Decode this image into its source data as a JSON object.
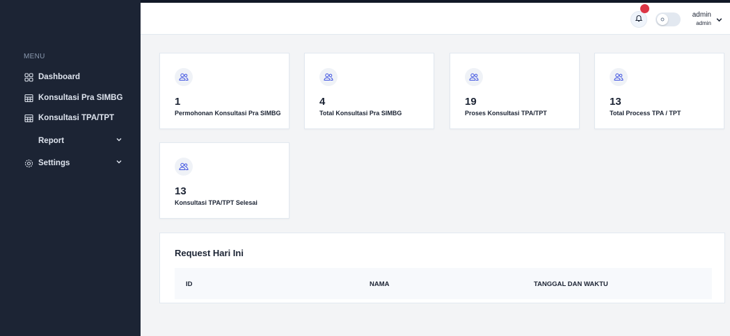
{
  "sidebar": {
    "menu_label": "MENU",
    "items": [
      {
        "label": "Dashboard",
        "icon": "grid-icon"
      },
      {
        "label": "Konsultasi Pra SIMBG",
        "icon": "table-icon"
      },
      {
        "label": "Konsultasi TPA/TPT",
        "icon": "table-icon"
      },
      {
        "label": "Report",
        "icon": "chevron-down-icon"
      },
      {
        "label": "Settings",
        "icon": "gear-icon"
      }
    ]
  },
  "header": {
    "user_name": "admin",
    "user_role": "admin",
    "notification_color": "#dc3545"
  },
  "cards": [
    {
      "value": "1",
      "label": "Permohonan Konsultasi Pra SIMBG"
    },
    {
      "value": "4",
      "label": "Total Konsultasi Pra SIMBG"
    },
    {
      "value": "19",
      "label": "Proses Konsultasi TPA/TPT"
    },
    {
      "value": "13",
      "label": "Total Process TPA / TPT"
    },
    {
      "value": "13",
      "label": "Konsultasi TPA/TPT Selesai"
    }
  ],
  "request_table": {
    "title": "Request Hari Ini",
    "columns": [
      "ID",
      "NAMA",
      "TANGGAL DAN WAKTU"
    ]
  },
  "colors": {
    "sidebar_bg": "#1c2434",
    "icon_accent": "#3c50e0"
  }
}
